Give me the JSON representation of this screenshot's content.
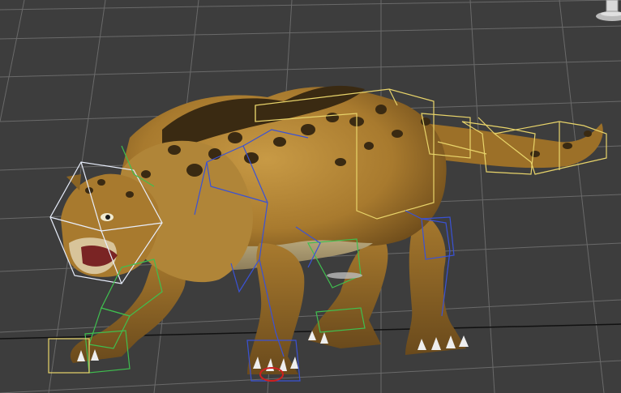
{
  "viewport": {
    "view": "perspective",
    "background_color": "#3d3d3d",
    "grid_color": "#6a6a6a"
  },
  "model": {
    "subject": "leopard",
    "fur_color": "#a87a2e",
    "spot_color": "#3a2a12"
  },
  "rig": {
    "colors": {
      "spine_tail_boxes": "#e8d46a",
      "head_box": "#e8eefc",
      "front_leg_bones": "#3fbf4f",
      "rear_leg_bones": "#3a52d6",
      "root_marker": "#d02020"
    }
  },
  "gizmos": {
    "transform_gizmo": "gizmo-icon"
  }
}
